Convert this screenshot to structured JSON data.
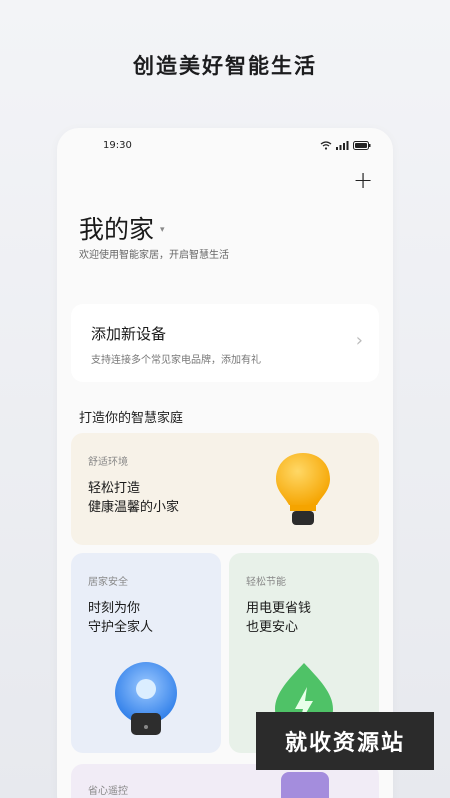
{
  "headline": "创造美好智能生活",
  "status_bar": {
    "time": "19:30"
  },
  "home": {
    "title": "我的家",
    "subtitle": "欢迎使用智能家居，开启智慧生活"
  },
  "add_device": {
    "title": "添加新设备",
    "subtitle": "支持连接多个常见家电品牌，添加有礼"
  },
  "section_title": "打造你的智慧家庭",
  "cards": {
    "comfort": {
      "tag": "舒适环境",
      "line1": "轻松打造",
      "line2": "健康温馨的小家"
    },
    "security": {
      "tag": "居家安全",
      "line1": "时刻为你",
      "line2": "守护全家人"
    },
    "energy": {
      "tag": "轻松节能",
      "line1": "用电更省钱",
      "line2": "也更安心"
    },
    "remote": {
      "tag": "省心遥控"
    }
  },
  "watermark": "就收资源站",
  "colors": {
    "bulb": "#ffbe1f",
    "security_glow": "#3f8ef2",
    "energy_leaf": "#55c46a"
  }
}
